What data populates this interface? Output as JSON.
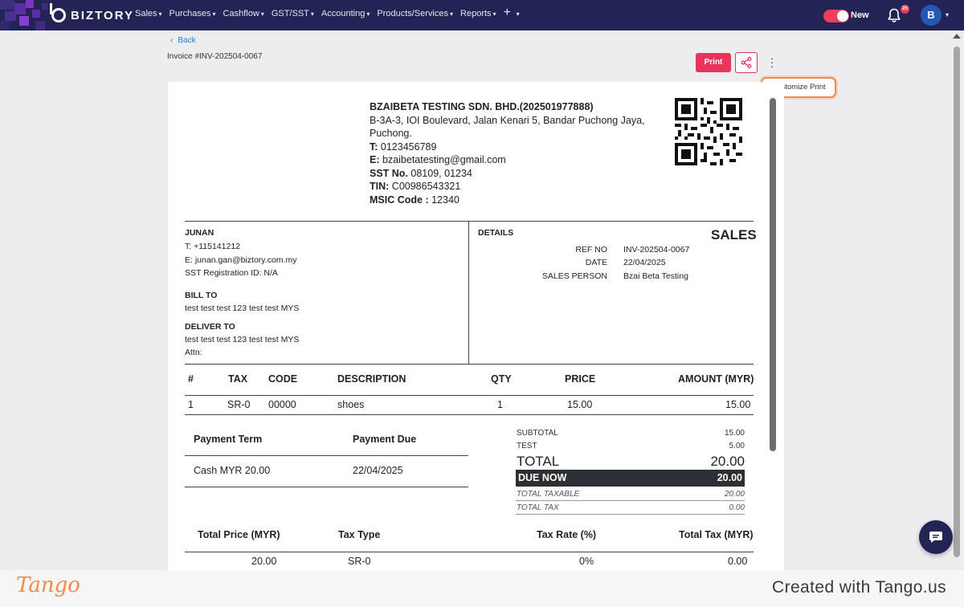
{
  "app": {
    "brand": "BIZTORY"
  },
  "nav": {
    "menu": [
      {
        "label": "Sales"
      },
      {
        "label": "Purchases"
      },
      {
        "label": "Cashflow"
      },
      {
        "label": "GST/SST"
      },
      {
        "label": "Accounting"
      },
      {
        "label": "Products/Services"
      },
      {
        "label": "Reports"
      }
    ],
    "toggle_label": "New",
    "toggle_on": true,
    "notification_count": "25",
    "avatar_initial": "B"
  },
  "page": {
    "back_label": "Back",
    "invoice_number": "Invoice #INV-202504-0067",
    "print_label": "Print",
    "customize_print_label": "Customize Print"
  },
  "company": {
    "name": "BZAIBETA TESTING SDN. BHD.(202501977888)",
    "address_line1": "B-3A-3, IOI Boulevard, Jalan Kenari 5, Bandar Puchong Jaya,",
    "address_line2": "Puchong.",
    "phone_label": "T:",
    "phone": "0123456789",
    "email_label": "E:",
    "email": "bzaibetatesting@gmail.com",
    "sst_label": "SST No.",
    "sst": "08109, 01234",
    "tin_label": "TIN:",
    "tin": "C00986543321",
    "msic_label": "MSIC Code :",
    "msic": "12340"
  },
  "customer": {
    "name": "JUNAN",
    "phone": "T: +115141212",
    "email": "E: junan.gan@biztory.com.my",
    "sst_id": "SST Registration ID: N/A",
    "bill_to_label": "BILL TO",
    "bill_to": "test test test 123 test test MYS",
    "deliver_to_label": "DELIVER TO",
    "deliver_to": "test test test 123 test test MYS",
    "attn": "Attn:"
  },
  "details": {
    "heading": "DETAILS",
    "doc_type": "SALES",
    "rows": [
      {
        "label": "REF NO",
        "value": "INV-202504-0067"
      },
      {
        "label": "DATE",
        "value": "22/04/2025"
      },
      {
        "label": "SALES PERSON",
        "value": "Bzai Beta Testing"
      }
    ]
  },
  "items_table": {
    "headers": [
      "#",
      "TAX",
      "CODE",
      "DESCRIPTION",
      "QTY",
      "PRICE",
      "AMOUNT (MYR)"
    ],
    "rows": [
      [
        "1",
        "SR-0",
        "00000",
        "shoes",
        "1",
        "15.00",
        "15.00"
      ]
    ]
  },
  "payment": {
    "term_label": "Payment Term",
    "due_label": "Payment Due",
    "term_value": "Cash MYR 20.00",
    "due_value": "22/04/2025"
  },
  "summary": {
    "subtotal_label": "SUBTOTAL",
    "subtotal": "15.00",
    "test_label": "TEST",
    "test": "5.00",
    "total_label": "TOTAL",
    "total": "20.00",
    "due_now_label": "DUE NOW",
    "due_now": "20.00",
    "total_taxable_label": "TOTAL TAXABLE",
    "total_taxable": "20.00",
    "total_tax_label": "TOTAL TAX",
    "total_tax": "0.00"
  },
  "tax_table": {
    "headers": [
      "Total Price (MYR)",
      "Tax Type",
      "Tax Rate (%)",
      "Total Tax (MYR)"
    ],
    "rows": [
      [
        "20.00",
        "SR-0",
        "0%",
        "0.00"
      ]
    ]
  },
  "footer": {
    "logo": "Tango",
    "created_with": "Created with Tango.us"
  },
  "colors": {
    "nav_bg": "#232455",
    "accent": "#e8335a",
    "highlight": "#f08b48",
    "link": "#2e7ad1"
  }
}
